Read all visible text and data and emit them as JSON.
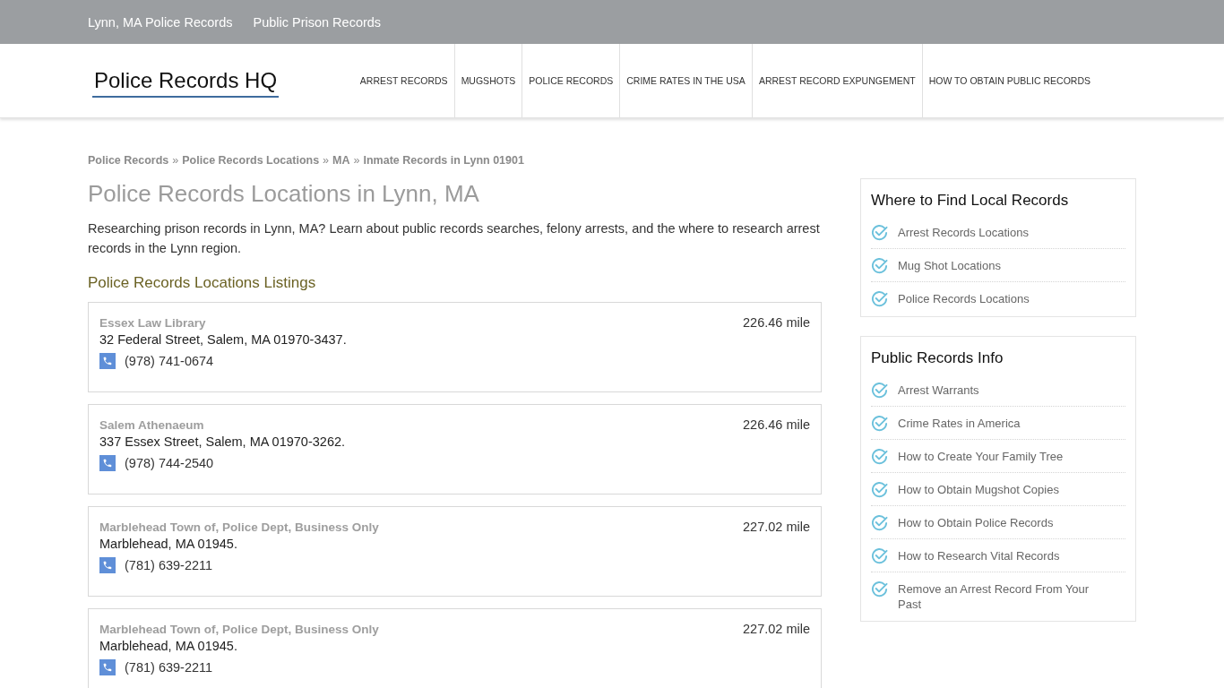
{
  "top_bar": {
    "links": [
      "Lynn, MA Police Records",
      "Public Prison Records"
    ]
  },
  "header": {
    "logo": "Police Records HQ",
    "nav": [
      "ARREST RECORDS",
      "MUGSHOTS",
      "POLICE RECORDS",
      "CRIME RATES IN THE USA",
      "ARREST RECORD EXPUNGEMENT",
      "HOW TO OBTAIN PUBLIC RECORDS"
    ]
  },
  "breadcrumbs": {
    "separator": "»",
    "items": [
      "Police Records",
      "Police Records Locations",
      "MA",
      "Inmate Records in Lynn 01901"
    ]
  },
  "title": "Police Records Locations in Lynn, MA",
  "intro": "Researching prison records in Lynn, MA? Learn about public records searches, felony arrests, and the where to research arrest records in the Lynn region.",
  "listings_heading": "Police Records Locations Listings",
  "listings": [
    {
      "name": "Essex Law Library",
      "distance": "226.46 mile",
      "address": "32 Federal Street, Salem, MA 01970-3437.",
      "phone": "(978) 741-0674"
    },
    {
      "name": "Salem Athenaeum",
      "distance": "226.46 mile",
      "address": "337 Essex Street, Salem, MA 01970-3262.",
      "phone": "(978) 744-2540"
    },
    {
      "name": "Marblehead Town of, Police Dept, Business Only",
      "distance": "227.02 mile",
      "address": "Marblehead, MA 01945.",
      "phone": "(781) 639-2211"
    },
    {
      "name": "Marblehead Town of, Police Dept, Business Only",
      "distance": "227.02 mile",
      "address": "Marblehead, MA 01945.",
      "phone": "(781) 639-2211"
    }
  ],
  "sidebar": [
    {
      "title": "Where to Find Local Records",
      "items": [
        "Arrest Records Locations",
        "Mug Shot Locations",
        "Police Records Locations"
      ]
    },
    {
      "title": "Public Records Info",
      "items": [
        "Arrest Warrants",
        "Crime Rates in America",
        "How to Create Your Family Tree",
        "How to Obtain Mugshot Copies",
        "How to Obtain Police Records",
        "How to Research Vital Records",
        "Remove an Arrest Record From Your Past"
      ]
    }
  ]
}
